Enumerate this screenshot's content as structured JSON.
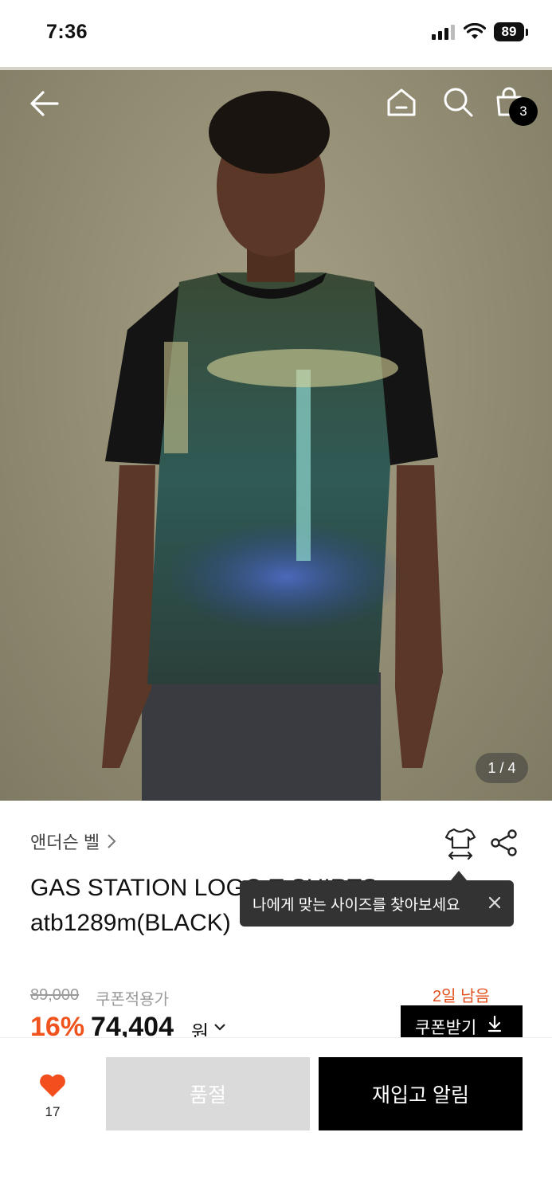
{
  "status_bar": {
    "time": "7:36",
    "battery": "89"
  },
  "header": {
    "cart_count": "3"
  },
  "gallery": {
    "counter": "1 / 4"
  },
  "product": {
    "brand": "앤더슨 벨",
    "title_line1": "GAS STATION LOGO T-SHIRTS",
    "title_line2": "atb1289m(BLACK)"
  },
  "tooltip": {
    "text": "나에게 맞는 사이즈를 찾아보세요"
  },
  "price": {
    "original": "89,000",
    "coupon_label": "쿠폰적용가",
    "discount": "16%",
    "sale": "74,404",
    "unit": "원",
    "days_left": "2일 남음",
    "coupon_button": "쿠폰받기"
  },
  "bottom_bar": {
    "like_count": "17",
    "soldout_label": "품절",
    "restock_label": "재입고 알림"
  },
  "colors": {
    "accent": "#f0531e",
    "heart": "#f24e1e"
  }
}
